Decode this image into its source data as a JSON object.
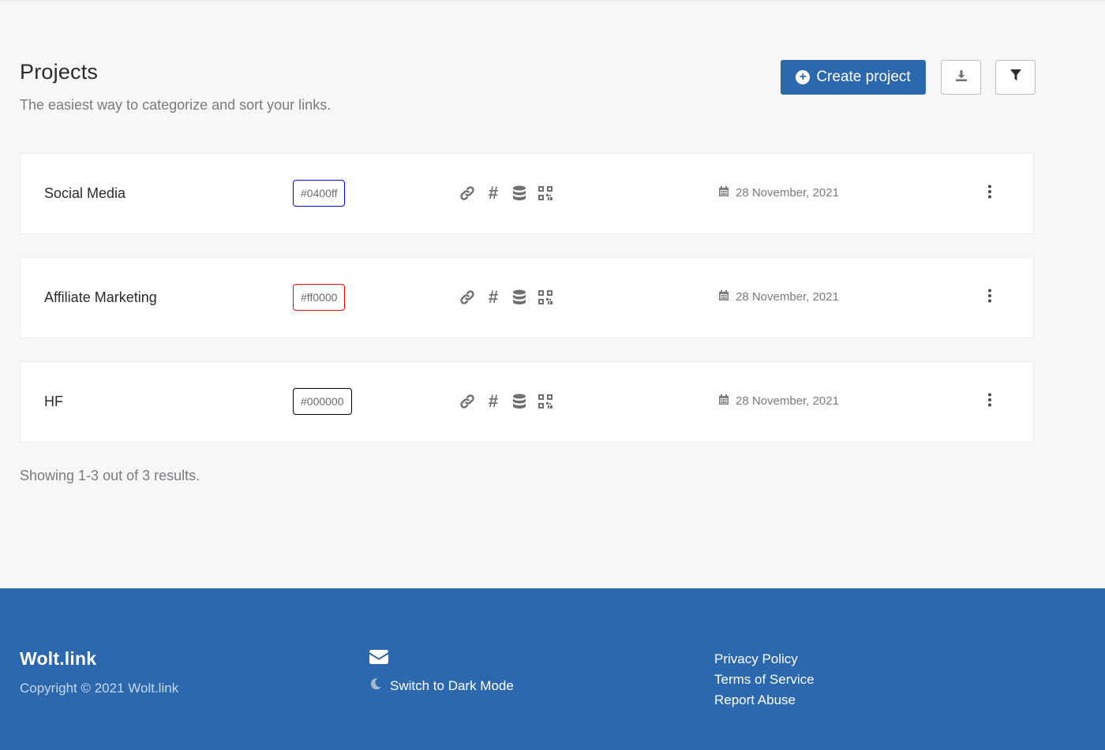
{
  "header": {
    "title": "Projects",
    "subtitle": "The easiest way to categorize and sort your links.",
    "create_label": "Create project"
  },
  "projects": [
    {
      "name": "Social Media",
      "color_code": "#0400ff",
      "date": "28 November, 2021"
    },
    {
      "name": "Affiliate Marketing",
      "color_code": "#ff0000",
      "date": "28 November, 2021"
    },
    {
      "name": "HF",
      "color_code": "#000000",
      "date": "28 November, 2021"
    }
  ],
  "results_text": "Showing 1-3 out of 3 results.",
  "footer": {
    "brand": "Wolt.link",
    "copyright": "Copyright © 2021 Wolt.link",
    "dark_mode_label": "Switch to Dark Mode",
    "links": [
      "Privacy Policy",
      "Terms of Service",
      "Report Abuse"
    ]
  },
  "colors": {
    "accent": "#2b68ad",
    "footer_bg": "#2b68ad"
  },
  "icons": {
    "create": "plus-circle-icon",
    "download": "download-icon",
    "filter": "filter-icon",
    "card_actions": [
      "link-icon",
      "hash-icon",
      "database-icon",
      "qr-code-icon"
    ],
    "date": "calendar-icon",
    "more": "more-vertical-icon",
    "mail": "envelope-icon",
    "dark_mode": "moon-icon"
  }
}
